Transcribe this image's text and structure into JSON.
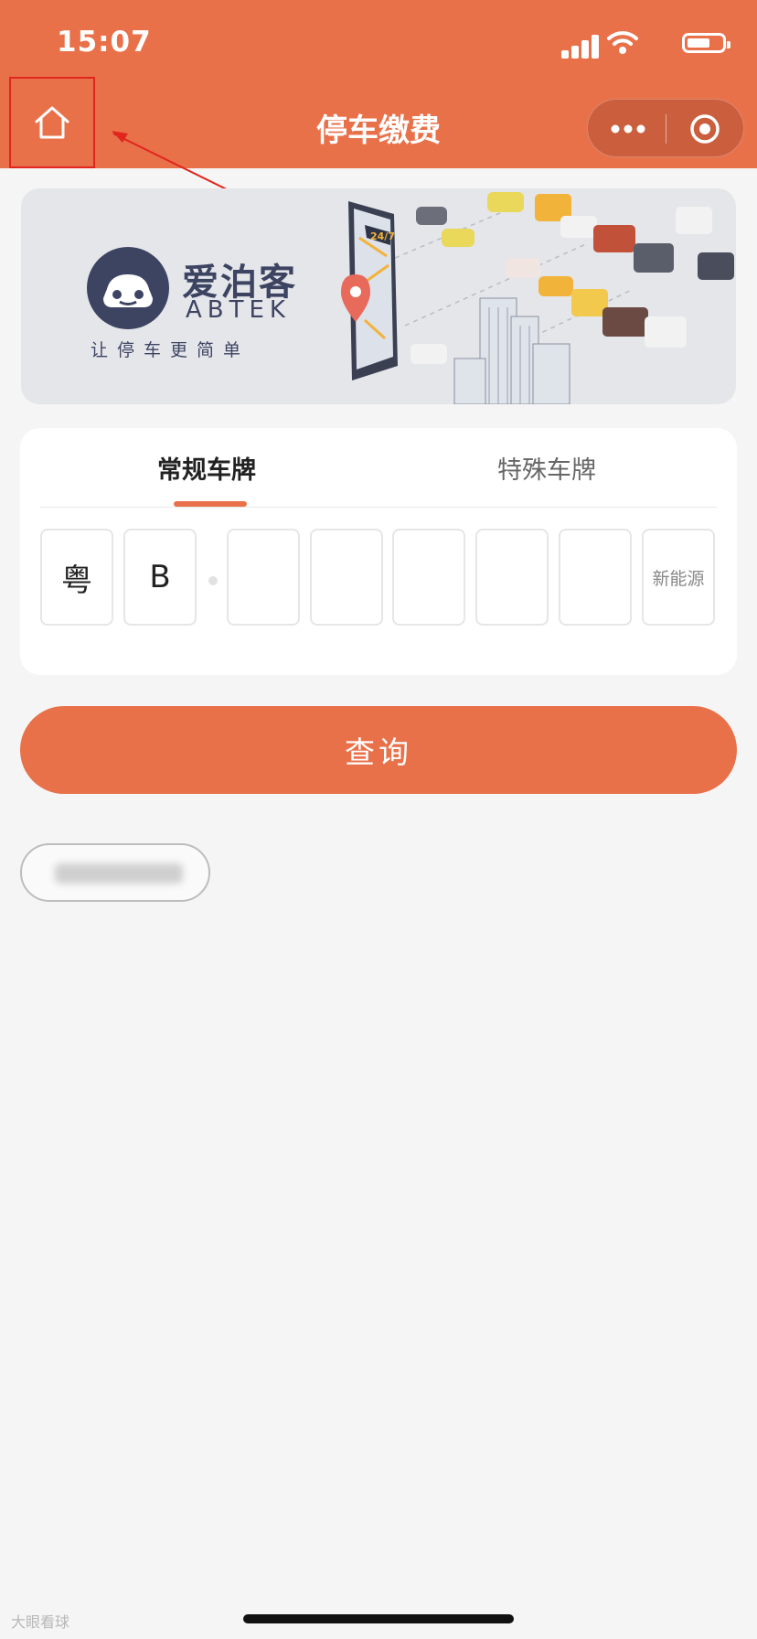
{
  "status_bar": {
    "time": "15:07"
  },
  "nav": {
    "title": "停车缴费"
  },
  "banner": {
    "brand_cn": "爱泊客",
    "brand_en": "ABTEK",
    "slogan": "让停车更简单",
    "sign_text": "24/7"
  },
  "plate_form": {
    "tabs": [
      {
        "label": "常规车牌",
        "active": true
      },
      {
        "label": "特殊车牌",
        "active": false
      }
    ],
    "chars": [
      "粤",
      "B",
      "",
      "",
      "",
      "",
      ""
    ],
    "new_energy_label": "新能源"
  },
  "query_button": {
    "label": "查询"
  },
  "watermark": {
    "text": "大眼看球"
  },
  "colors": {
    "accent": "#e9714a",
    "annotation": "#e0261e"
  },
  "icons": [
    "home-icon",
    "more-icon",
    "target-icon",
    "signal-icon",
    "wifi-icon",
    "battery-icon"
  ]
}
